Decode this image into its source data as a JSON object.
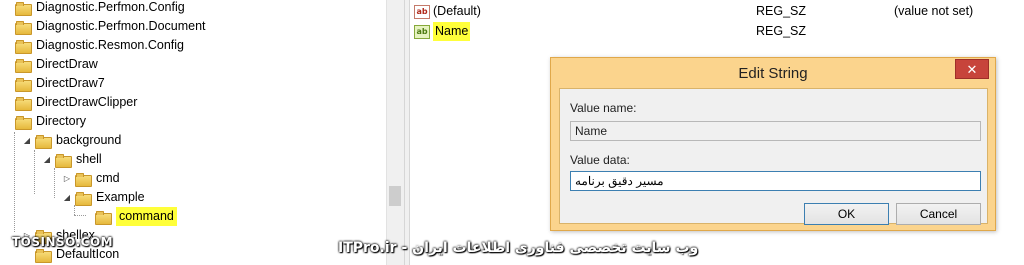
{
  "tree": {
    "items": [
      {
        "label": "Diagnostic.Perfmon.Config",
        "indent": 0,
        "expander": ""
      },
      {
        "label": "Diagnostic.Perfmon.Document",
        "indent": 0,
        "expander": ""
      },
      {
        "label": "Diagnostic.Resmon.Config",
        "indent": 0,
        "expander": ""
      },
      {
        "label": "DirectDraw",
        "indent": 0,
        "expander": ""
      },
      {
        "label": "DirectDraw7",
        "indent": 0,
        "expander": ""
      },
      {
        "label": "DirectDrawClipper",
        "indent": 0,
        "expander": ""
      },
      {
        "label": "Directory",
        "indent": 0,
        "expander": ""
      },
      {
        "label": "background",
        "indent": 1,
        "expander": "◢"
      },
      {
        "label": "shell",
        "indent": 2,
        "expander": "◢"
      },
      {
        "label": "cmd",
        "indent": 3,
        "expander": "▷"
      },
      {
        "label": "Example",
        "indent": 3,
        "expander": "◢"
      },
      {
        "label": "command",
        "indent": 4,
        "expander": "",
        "highlighted": true
      },
      {
        "label": "shellex",
        "indent": 1,
        "expander": "▷"
      },
      {
        "label": "DefaultIcon",
        "indent": 1,
        "expander": ""
      }
    ]
  },
  "values": {
    "rows": [
      {
        "name": "(Default)",
        "type": "REG_SZ",
        "data": "(value not set)"
      },
      {
        "name": "Name",
        "type": "REG_SZ",
        "data": "",
        "highlighted": true
      }
    ]
  },
  "dialog": {
    "title": "Edit String",
    "close_glyph": "✕",
    "value_name_label": "Value name:",
    "value_name": "Name",
    "value_data_label": "Value data:",
    "value_data": "مسیر دقیق برنامه",
    "ok_label": "OK",
    "cancel_label": "Cancel"
  },
  "watermarks": {
    "left": "TOSINSO.COM",
    "right": "ITPro.ir - وب سایت تخصصی فناوری اطلاعات ایران"
  },
  "colors": {
    "highlight": "#ffff3a",
    "dialog_frame": "#fbd48d",
    "close_button": "#c7443b"
  }
}
